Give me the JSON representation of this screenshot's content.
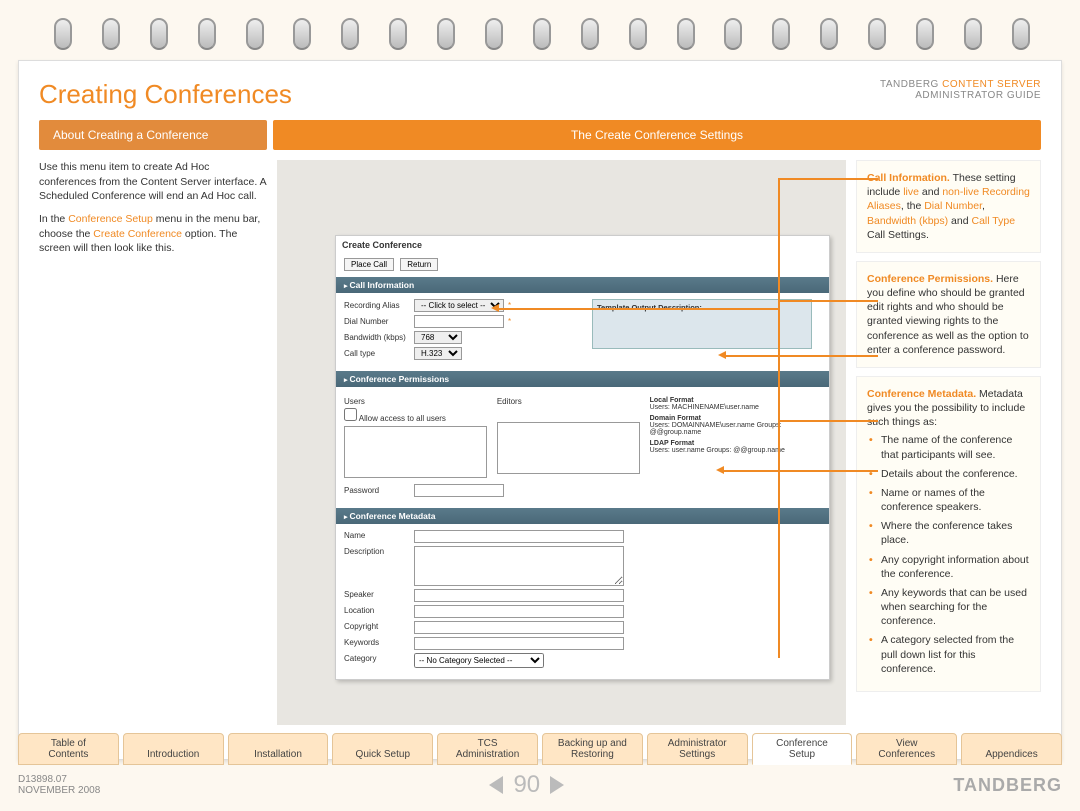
{
  "header": {
    "title": "Creating Conferences",
    "brand_line1_a": "TANDBERG",
    "brand_line1_b": "CONTENT SERVER",
    "brand_line2": "ADMINISTRATOR GUIDE"
  },
  "tabs": {
    "t1": "About Creating a Conference",
    "t2": "The Create Conference Settings"
  },
  "left": {
    "p1": "Use this menu item to create Ad Hoc conferences from the Content Server interface. A Scheduled Conference will end an Ad Hoc call.",
    "p2a": "In the ",
    "p2b": "Conference Setup",
    "p2c": " menu in the menu bar, choose the ",
    "p2d": "Create Conference",
    "p2e": " option. The screen will then look like this."
  },
  "panel": {
    "title": "Create Conference",
    "btn_place": "Place Call",
    "btn_return": "Return",
    "sec_callinfo": "Call Information",
    "li_rec_alias": "Recording Alias",
    "sel_click": "-- Click to select --",
    "li_dialnum": "Dial Number",
    "li_bw": "Bandwidth (kbps)",
    "sel_bw": "768",
    "li_calltype": "Call type",
    "sel_ct": "H.323",
    "tod": "Template Output Description:",
    "sec_perm": "Conference Permissions",
    "perm_users": "Users",
    "perm_editors": "Editors",
    "cb_allow": "Allow access to all users",
    "fmt_local": "Local Format",
    "fmt_local_v": "Users: MACHINENAME\\user.name",
    "fmt_domain": "Domain Format",
    "fmt_domain_v": "Users: DOMAINNAME\\user.name Groups: @@group.name",
    "fmt_ldap": "LDAP Format",
    "fmt_ldap_v": "Users: user.name Groups: @@group.name",
    "pw_label": "Password",
    "sec_meta": "Conference Metadata",
    "m_name": "Name",
    "m_desc": "Description",
    "m_speaker": "Speaker",
    "m_loc": "Location",
    "m_copy": "Copyright",
    "m_kw": "Keywords",
    "m_cat": "Category",
    "sel_cat": "-- No Category Selected --"
  },
  "callouts": {
    "c1_a": "Call Information.",
    "c1_b": " These setting include ",
    "c1_c": "live",
    "c1_d": " and ",
    "c1_e": "non-live Recording Aliases",
    "c1_f": ", the ",
    "c1_g": "Dial Number",
    "c1_h": ", ",
    "c1_i": "Bandwidth (kbps)",
    "c1_j": " and ",
    "c1_k": "Call Type",
    "c1_l": " Call Settings.",
    "c2_a": "Conference Permissions.",
    "c2_b": " Here you define who should be granted edit rights and who should be granted viewing rights to the conference as well as the option to enter a conference password.",
    "c3_a": "Conference Metadata.",
    "c3_b": " Metadata gives you the possibility to include such things as:",
    "c3_li1": "The name of the conference that participants will see.",
    "c3_li2": "Details about the conference.",
    "c3_li3": "Name or names of the conference speakers.",
    "c3_li4": "Where the conference takes place.",
    "c3_li5": "Any copyright information about the conference.",
    "c3_li6": "Any keywords that can be used when searching for the conference.",
    "c3_li7": "A category selected from the pull down list for this conference."
  },
  "nav": {
    "n1a": "Table of",
    "n1b": "Contents",
    "n2": "Introduction",
    "n3": "Installation",
    "n4": "Quick Setup",
    "n5a": "TCS",
    "n5b": "Administration",
    "n6a": "Backing up and",
    "n6b": "Restoring",
    "n7a": "Administrator",
    "n7b": "Settings",
    "n8a": "Conference",
    "n8b": "Setup",
    "n9a": "View",
    "n9b": "Conferences",
    "n10": "Appendices"
  },
  "footer": {
    "doc": "D13898.07",
    "date": "NOVEMBER 2008",
    "page": "90",
    "logo": "TANDBERG"
  }
}
